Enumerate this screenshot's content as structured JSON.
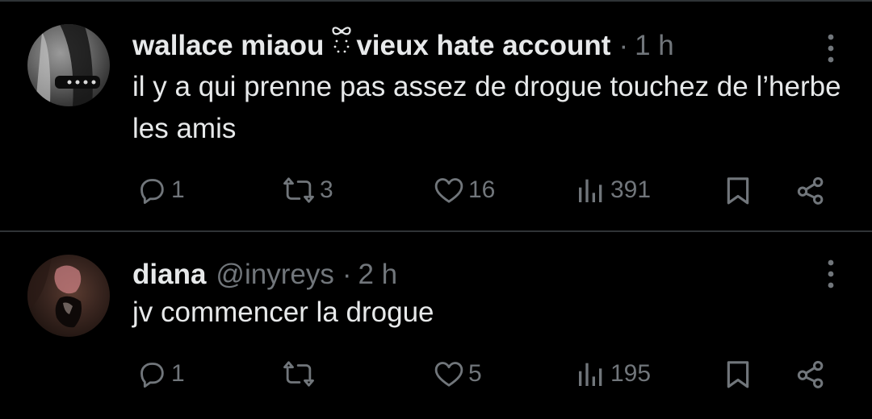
{
  "tweets": [
    {
      "display_name": "wallace miaou",
      "name_suffix": "vieux hate account",
      "handle": "",
      "separator": "·",
      "time": "1 h",
      "text": "il y a qui prenne pas assez de drogue touchez de l’herbe les amis",
      "replies": "1",
      "retweets": "3",
      "likes": "16",
      "views": "391"
    },
    {
      "display_name": "diana",
      "handle": "@inyreys",
      "separator": "·",
      "time": "2 h",
      "text": "jv commencer la drogue",
      "replies": "1",
      "retweets": "",
      "likes": "5",
      "views": "195"
    }
  ],
  "icons": {
    "reply": "reply-icon",
    "retweet": "retweet-icon",
    "like": "heart-icon",
    "views": "views-icon",
    "bookmark": "bookmark-icon",
    "share": "share-icon",
    "more": "more-vertical-icon",
    "emoji": "ribbon-bow-emoji"
  },
  "colors": {
    "background": "#000000",
    "text": "#e7e9ea",
    "muted": "#71767b",
    "divider": "#2f3336"
  }
}
